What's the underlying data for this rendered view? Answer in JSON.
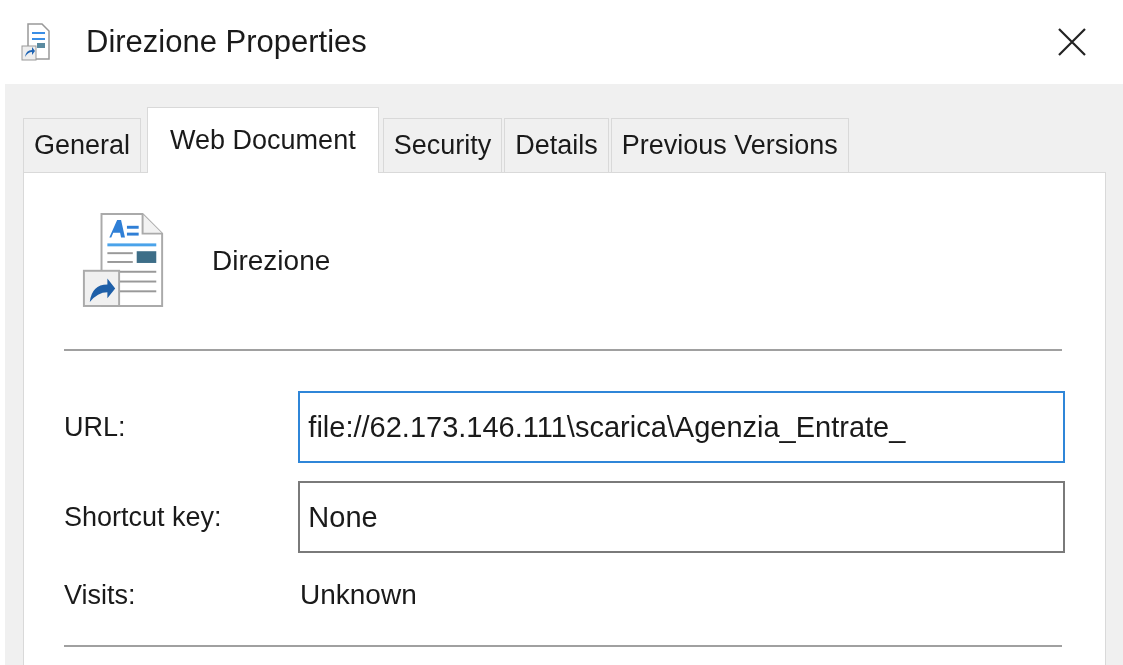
{
  "window": {
    "title": "Direzione Properties"
  },
  "tabs": [
    {
      "label": "General",
      "selected": false
    },
    {
      "label": "Web Document",
      "selected": true
    },
    {
      "label": "Security",
      "selected": false
    },
    {
      "label": "Details",
      "selected": false
    },
    {
      "label": "Previous Versions",
      "selected": false
    }
  ],
  "file": {
    "name": "Direzione"
  },
  "fields": [
    {
      "label": "URL:",
      "value": "file://62.173.146.111\\scarica\\Agenzia_Entrate_",
      "focused": true
    },
    {
      "label": "Shortcut key:",
      "value": "None",
      "focused": false
    }
  ],
  "visits": {
    "label": "Visits:",
    "value": "Unknown"
  }
}
